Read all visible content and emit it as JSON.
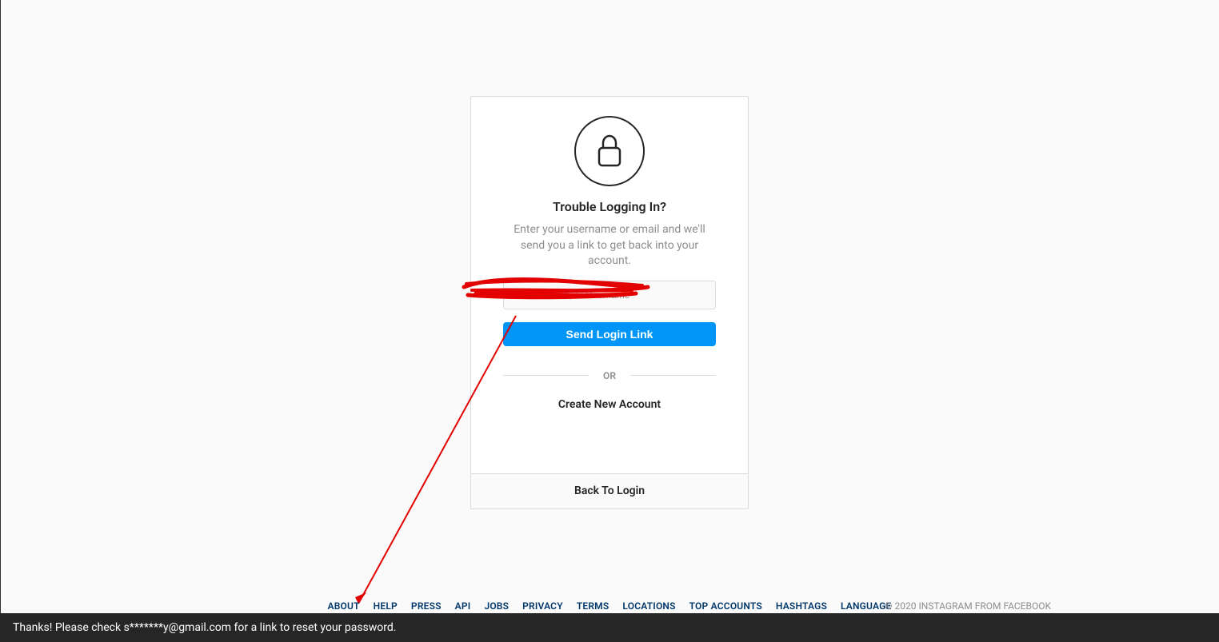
{
  "card": {
    "title": "Trouble Logging In?",
    "description": "Enter your username or email and we'll send you a link to get back into your account.",
    "input_placeholder": "Email, Phone, or Username",
    "send_button": "Send Login Link",
    "or": "OR",
    "create_account": "Create New Account",
    "back_to_login": "Back To Login"
  },
  "footer": {
    "links": [
      "ABOUT",
      "HELP",
      "PRESS",
      "API",
      "JOBS",
      "PRIVACY",
      "TERMS",
      "LOCATIONS",
      "TOP ACCOUNTS",
      "HASHTAGS",
      "LANGUAGE"
    ],
    "copyright": "© 2020 INSTAGRAM FROM FACEBOOK"
  },
  "toast": "Thanks! Please check s*******y@gmail.com for a link to reset your password."
}
